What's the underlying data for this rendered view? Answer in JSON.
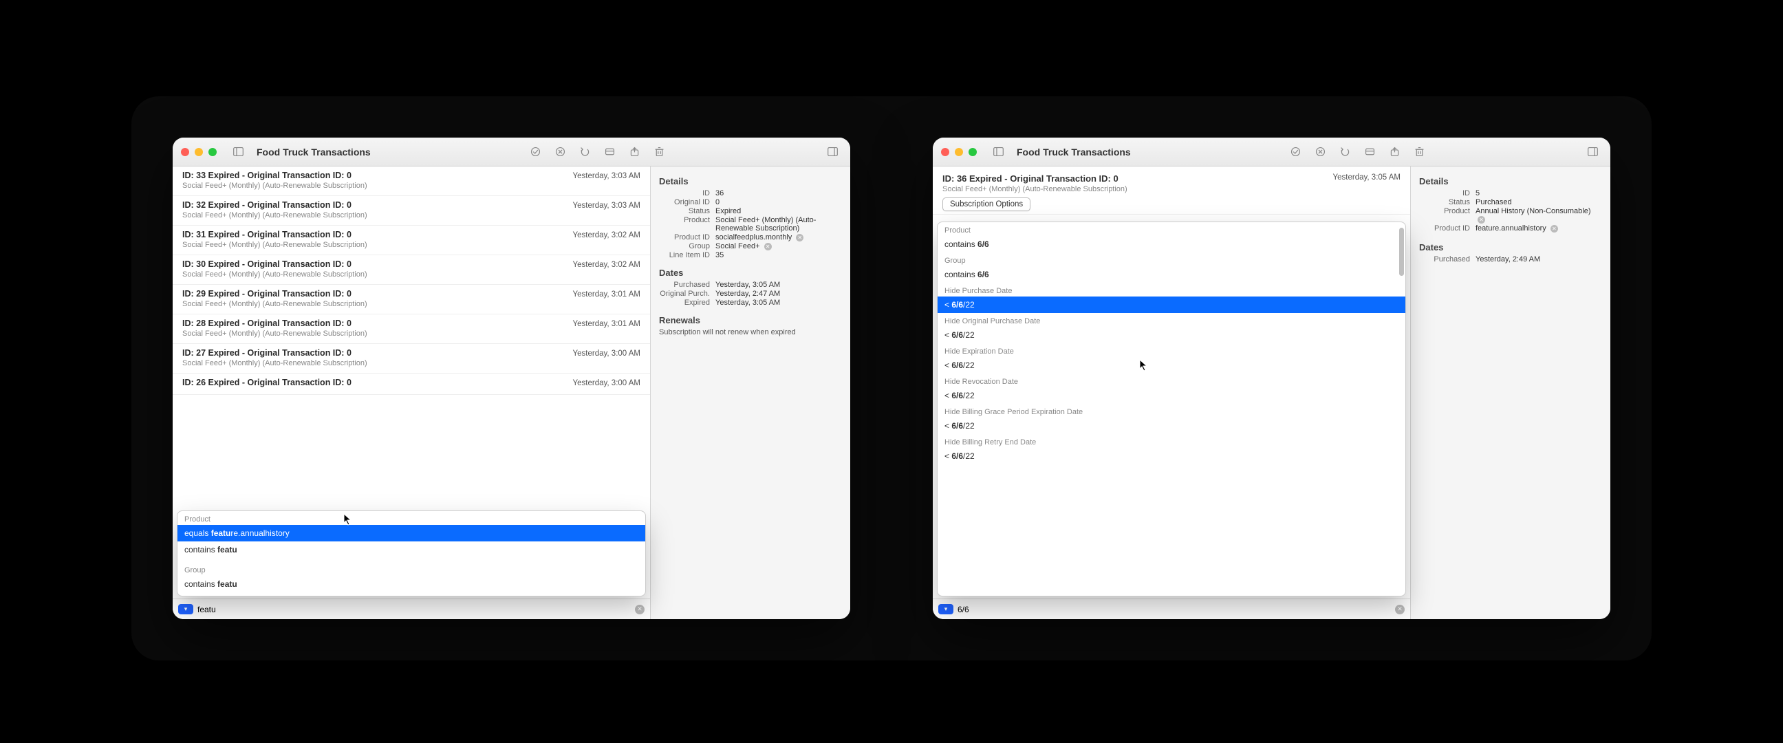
{
  "left": {
    "title": "Food Truck Transactions",
    "rows": [
      {
        "title": "ID: 33 Expired - Original Transaction ID: 0",
        "sub": "Social Feed+ (Monthly) (Auto-Renewable Subscription)",
        "time": "Yesterday, 3:03 AM"
      },
      {
        "title": "ID: 32 Expired - Original Transaction ID: 0",
        "sub": "Social Feed+ (Monthly) (Auto-Renewable Subscription)",
        "time": "Yesterday, 3:03 AM"
      },
      {
        "title": "ID: 31 Expired - Original Transaction ID: 0",
        "sub": "Social Feed+ (Monthly) (Auto-Renewable Subscription)",
        "time": "Yesterday, 3:02 AM"
      },
      {
        "title": "ID: 30 Expired - Original Transaction ID: 0",
        "sub": "Social Feed+ (Monthly) (Auto-Renewable Subscription)",
        "time": "Yesterday, 3:02 AM"
      },
      {
        "title": "ID: 29 Expired - Original Transaction ID: 0",
        "sub": "Social Feed+ (Monthly) (Auto-Renewable Subscription)",
        "time": "Yesterday, 3:01 AM"
      },
      {
        "title": "ID: 28 Expired - Original Transaction ID: 0",
        "sub": "Social Feed+ (Monthly) (Auto-Renewable Subscription)",
        "time": "Yesterday, 3:01 AM"
      },
      {
        "title": "ID: 27 Expired - Original Transaction ID: 0",
        "sub": "Social Feed+ (Monthly) (Auto-Renewable Subscription)",
        "time": "Yesterday, 3:00 AM"
      },
      {
        "title": "ID: 26 Expired - Original Transaction ID: 0",
        "sub": "",
        "time": "Yesterday, 3:00 AM"
      }
    ],
    "details": {
      "heading": "Details",
      "id": "36",
      "original_id": "0",
      "status": "Expired",
      "product": "Social Feed+ (Monthly) (Auto-Renewable Subscription)",
      "product_id": "socialfeedplus.monthly",
      "group": "Social Feed+",
      "line_item_id": "35"
    },
    "dates": {
      "heading": "Dates",
      "purchased": "Yesterday, 3:05 AM",
      "original_purch": "Yesterday, 2:47 AM",
      "expired": "Yesterday, 3:05 AM"
    },
    "renewals": {
      "heading": "Renewals",
      "text": "Subscription will not renew when expired"
    },
    "labels": {
      "id": "ID",
      "original_id": "Original ID",
      "status": "Status",
      "product": "Product",
      "product_id": "Product ID",
      "group": "Group",
      "line_item_id": "Line Item ID",
      "purchased": "Purchased",
      "original_purch": "Original Purch.",
      "expired": "Expired"
    },
    "popup": {
      "product_head": "Product",
      "equals_prefix": "equals ",
      "equals_bold": "featu",
      "equals_rest": "re.annualhistory",
      "contains_prefix": "contains ",
      "contains_bold": "featu",
      "group_head": "Group",
      "group_contains_prefix": "contains ",
      "group_contains_bold": "featu"
    },
    "search_value": "featu"
  },
  "right": {
    "title": "Food Truck Transactions",
    "header": {
      "title": "ID: 36 Expired - Original Transaction ID: 0",
      "sub": "Social Feed+ (Monthly) (Auto-Renewable Subscription)",
      "time": "Yesterday, 3:05 AM",
      "button": "Subscription Options"
    },
    "filters": [
      {
        "head": "Product",
        "prefix": "contains ",
        "bold": "6/6",
        "rest": ""
      },
      {
        "head": "Group",
        "prefix": "contains ",
        "bold": "6/6",
        "rest": ""
      },
      {
        "head": "Hide Purchase Date",
        "prefix": "< ",
        "bold": "6/6",
        "rest": "/22",
        "sel": true
      },
      {
        "head": "Hide Original Purchase Date",
        "prefix": "< ",
        "bold": "6/6",
        "rest": "/22"
      },
      {
        "head": "Hide Expiration Date",
        "prefix": "< ",
        "bold": "6/6",
        "rest": "/22"
      },
      {
        "head": "Hide Revocation Date",
        "prefix": "< ",
        "bold": "6/6",
        "rest": "/22"
      },
      {
        "head": "Hide Billing Grace Period Expiration Date",
        "prefix": "< ",
        "bold": "6/6",
        "rest": "/22"
      },
      {
        "head": "Hide Billing Retry End Date",
        "prefix": "< ",
        "bold": "6/6",
        "rest": "/22"
      }
    ],
    "details": {
      "heading": "Details",
      "id": "5",
      "status": "Purchased",
      "product": "Annual History (Non-Consumable)",
      "product_id": "feature.annualhistory"
    },
    "dates": {
      "heading": "Dates",
      "purchased": "Yesterday, 2:49 AM"
    },
    "labels": {
      "id": "ID",
      "status": "Status",
      "product": "Product",
      "product_id": "Product ID",
      "purchased": "Purchased"
    },
    "search_value": "6/6"
  }
}
